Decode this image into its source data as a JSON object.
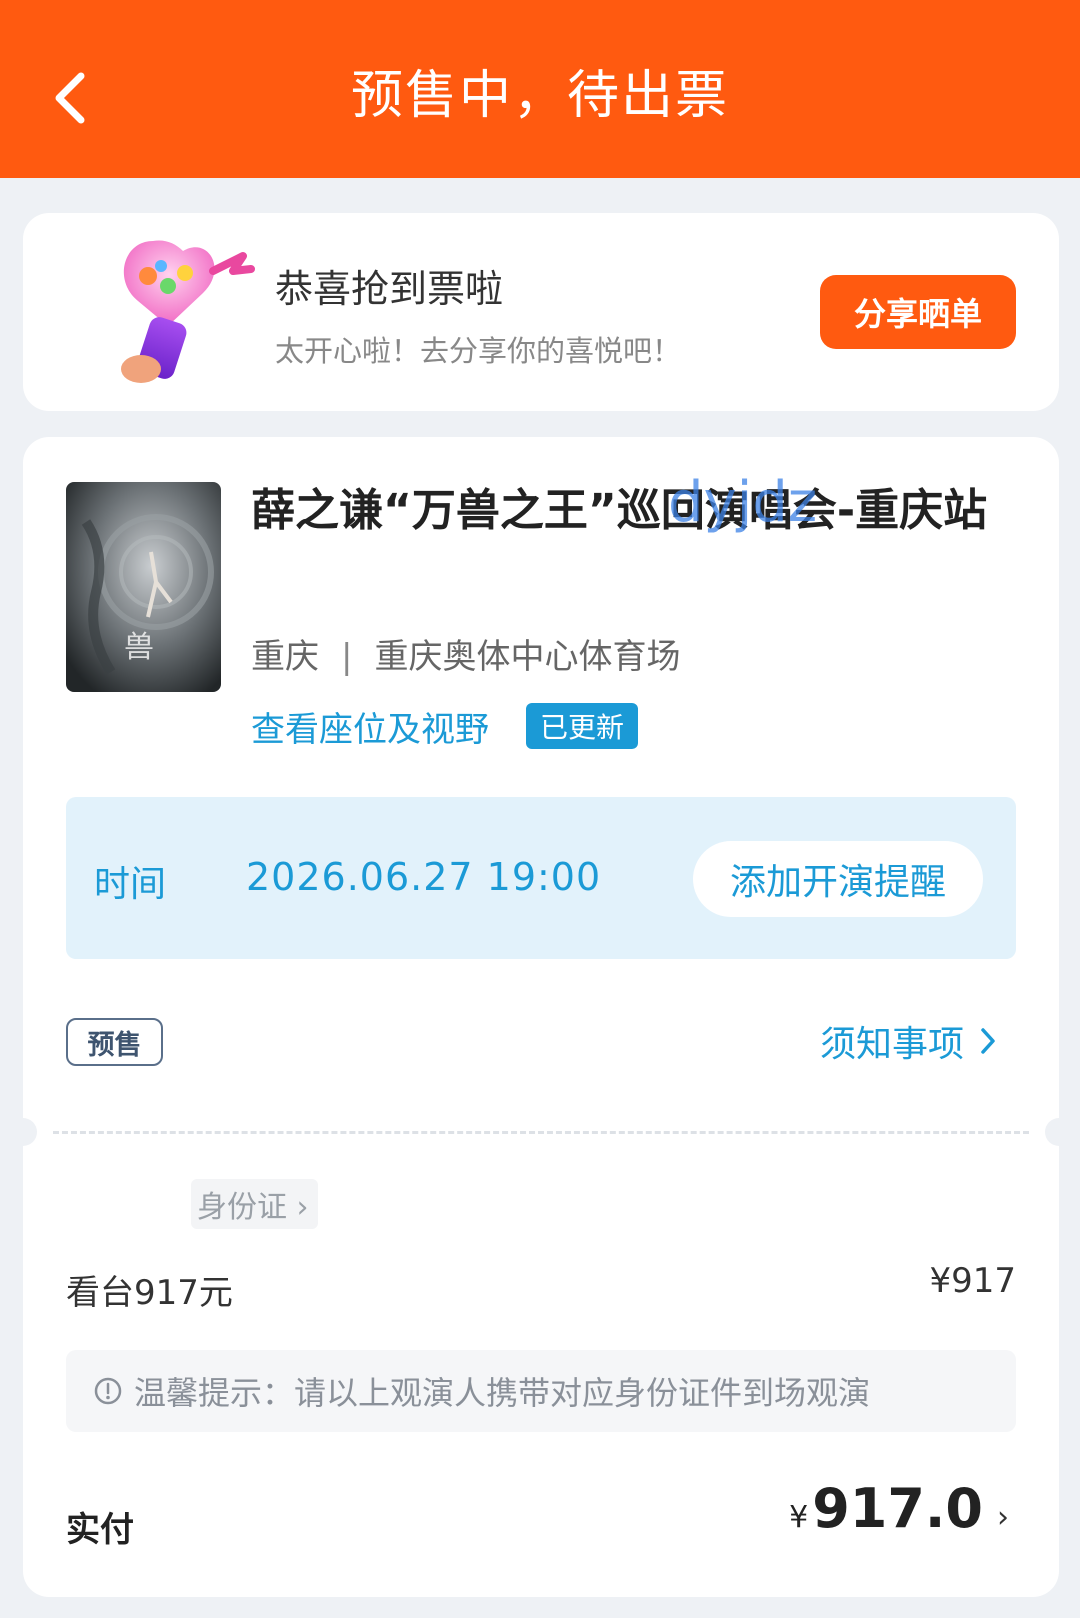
{
  "header": {
    "title": "预售中，待出票"
  },
  "congrats": {
    "title": "恭喜抢到票啦",
    "subtitle": "太开心啦！去分享你的喜悦吧！",
    "share_label": "分享晒单"
  },
  "event": {
    "title": "薛之谦“万兽之王”巡回演唱会-重庆站",
    "watermark": "dyjdz",
    "city": "重庆",
    "separator": "|",
    "venue": "重庆奥体中心体育场",
    "seat_link": "查看座位及视野",
    "updated_badge": "已更新"
  },
  "time": {
    "label": "时间",
    "value": "2026.06.27 19:00",
    "reminder_label": "添加开演提醒"
  },
  "tag": {
    "presale": "预售"
  },
  "notice": {
    "label": "须知事项"
  },
  "ticket": {
    "id_chip": "身份证 ›",
    "name": "看台917元",
    "price": "¥917"
  },
  "tip": {
    "text": "温馨提示：请以上观演人携带对应身份证件到场观演"
  },
  "payment": {
    "label": "实付",
    "currency": "¥",
    "amount": "917.0",
    "chevron": "›"
  },
  "colors": {
    "header": "#ff5a10",
    "accent": "#1b9ad6",
    "share": "#ff5a10"
  }
}
